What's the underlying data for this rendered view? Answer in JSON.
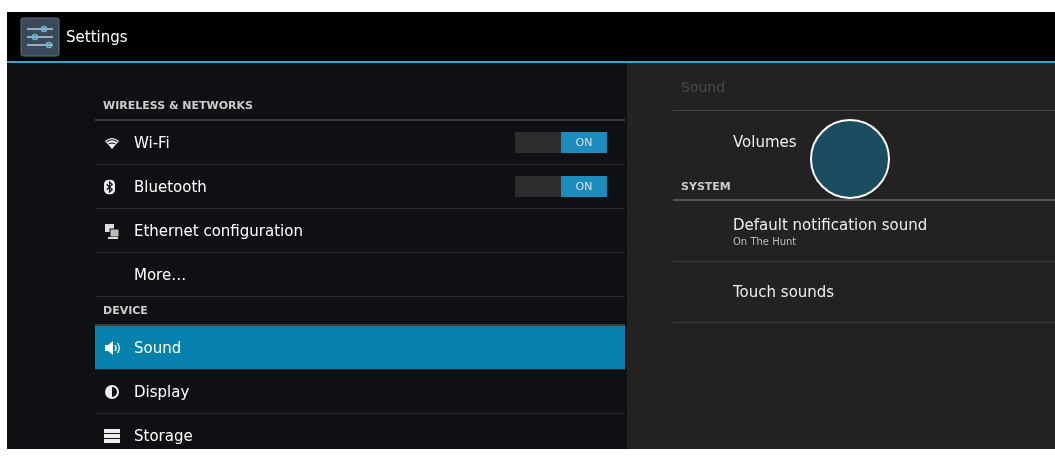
{
  "action_bar": {
    "title": "Settings"
  },
  "sidebar": {
    "items": [
      {
        "kind": "header",
        "label": "WIRELESS & NETWORKS"
      },
      {
        "kind": "item",
        "label": "Wi-Fi",
        "selected": false,
        "toggle": {
          "on": true,
          "label": "ON"
        }
      },
      {
        "kind": "item",
        "label": "Bluetooth",
        "selected": false,
        "toggle": {
          "on": true,
          "label": "ON"
        }
      },
      {
        "kind": "item",
        "label": "Ethernet configuration",
        "selected": false
      },
      {
        "kind": "item",
        "label": "More…",
        "selected": false
      },
      {
        "kind": "header",
        "label": "DEVICE"
      },
      {
        "kind": "item",
        "label": "Sound",
        "selected": true
      },
      {
        "kind": "item",
        "label": "Display",
        "selected": false
      },
      {
        "kind": "item",
        "label": "Storage",
        "selected": false
      }
    ]
  },
  "detail": {
    "title": "Sound",
    "items": [
      {
        "kind": "item",
        "label": "Volumes"
      },
      {
        "kind": "header",
        "label": "SYSTEM"
      },
      {
        "kind": "item",
        "label": "Default notification sound",
        "summary": "On The Hunt"
      },
      {
        "kind": "item",
        "label": "Touch sounds"
      }
    ]
  }
}
